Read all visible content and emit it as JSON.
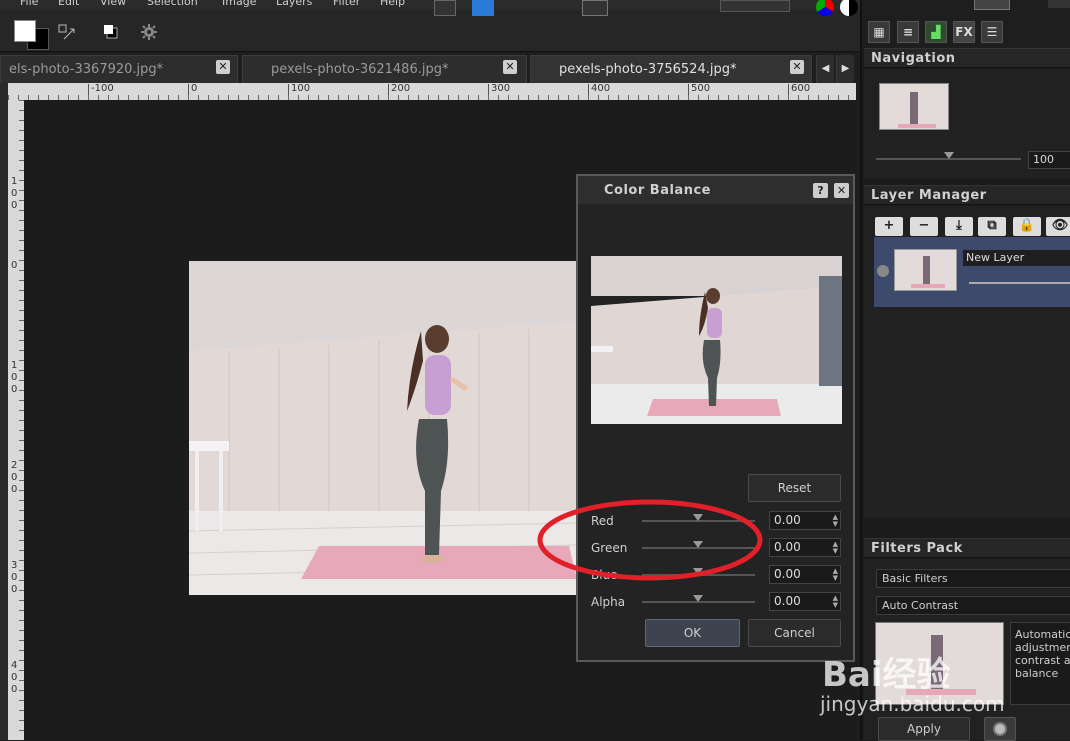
{
  "menubar": [
    "File",
    "Edit",
    "View",
    "Selection",
    "Image",
    "Layers",
    "Filter",
    "Help"
  ],
  "tabs": [
    {
      "label": "els-photo-3367920.jpg*",
      "close": "✕"
    },
    {
      "label": "pexels-photo-3621486.jpg*",
      "close": "✕"
    },
    {
      "label": "pexels-photo-3756524.jpg*",
      "close": "✕"
    }
  ],
  "tab_nav": {
    "prev": "◀",
    "next": "▶"
  },
  "ruler": {
    "h_labels": [
      "-100",
      "0",
      "100",
      "200",
      "300",
      "400",
      "500",
      "600"
    ],
    "v_labels": [
      "1\n0\n0",
      "0",
      "1\n0\n0",
      "2\n0\n0",
      "3\n0\n0",
      "4\n0\n0"
    ]
  },
  "dialog": {
    "title": "Color Balance",
    "help": "?",
    "close": "✕",
    "reset": "Reset",
    "ok": "OK",
    "cancel": "Cancel",
    "sliders": [
      {
        "label": "Red",
        "value": "0.00"
      },
      {
        "label": "Green",
        "value": "0.00"
      },
      {
        "label": "Blue",
        "value": "0.00"
      },
      {
        "label": "Alpha",
        "value": "0.00"
      }
    ]
  },
  "panel": {
    "fx": "FX",
    "navigation": {
      "title": "Navigation",
      "zoom": "100"
    },
    "layers": {
      "title": "Layer Manager",
      "layer_name": "New Layer",
      "tools": [
        "+",
        "−",
        "⤓",
        "⧉",
        "🔒",
        "👁"
      ]
    },
    "filters": {
      "title": "Filters Pack",
      "category": "Basic Filters",
      "filter": "Auto Contrast",
      "description": "Automatic adjustment contrast a balance",
      "apply": "Apply"
    }
  },
  "watermark": {
    "logo": "Bai经验",
    "url": "jingyan.baidu.com"
  }
}
